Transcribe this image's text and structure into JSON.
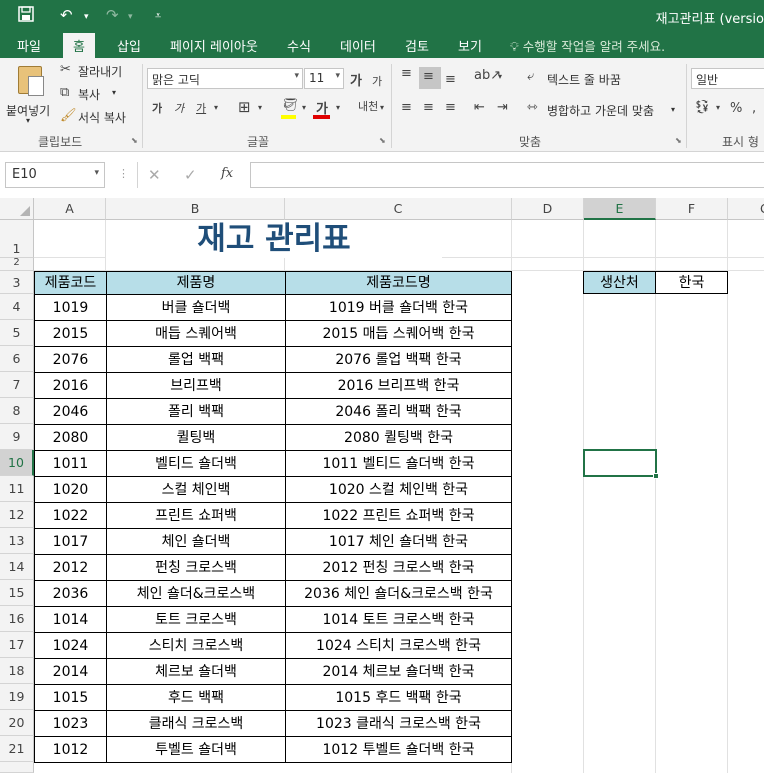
{
  "window": {
    "title": "재고관리표 (versio"
  },
  "menu_tabs": [
    {
      "label": "파일"
    },
    {
      "label": "홈"
    },
    {
      "label": "삽입"
    },
    {
      "label": "페이지 레이아웃"
    },
    {
      "label": "수식"
    },
    {
      "label": "데이터"
    },
    {
      "label": "검토"
    },
    {
      "label": "보기"
    }
  ],
  "tell_me": "수행할 작업을 알려 주세요.",
  "ribbon": {
    "paste_label": "붙여넣기",
    "cut_label": "잘라내기",
    "copy_label": "복사",
    "format_painter_label": "서식 복사",
    "clipboard_group": "클립보드",
    "font_name": "맑은 고딕",
    "font_size": "11",
    "font_group": "글꼴",
    "wrap_text": "텍스트 줄 바꿈",
    "merge_center": "병합하고 가운데 맞춤",
    "alignment_group": "맞춤",
    "number_format": "일반",
    "number_group": "표시 형"
  },
  "formula_bar": {
    "name_box": "E10",
    "fx": "fx",
    "formula": ""
  },
  "columns": [
    "A",
    "B",
    "C",
    "D",
    "E",
    "F",
    "G"
  ],
  "rows": [
    "1",
    "2",
    "3",
    "4",
    "5",
    "6",
    "7",
    "8",
    "9",
    "10",
    "11",
    "12",
    "13",
    "14",
    "15",
    "16",
    "17",
    "18",
    "19",
    "20",
    "21"
  ],
  "sheet": {
    "title": "재고 관리표",
    "headers": [
      "제품코드",
      "제품명",
      "제품코드명"
    ],
    "items": [
      [
        "1019",
        "버클 숄더백",
        "1019 버클 숄더백 한국"
      ],
      [
        "2015",
        "매듭 스퀘어백",
        "2015 매듭 스퀘어백 한국"
      ],
      [
        "2076",
        "롤업 백팩",
        "2076 롤업 백팩 한국"
      ],
      [
        "2016",
        "브리프백",
        "2016 브리프백 한국"
      ],
      [
        "2046",
        "폴리 백팩",
        "2046 폴리 백팩 한국"
      ],
      [
        "2080",
        "퀼팅백",
        "2080 퀼팅백 한국"
      ],
      [
        "1011",
        "벨티드 숄더백",
        "1011 벨티드 숄더백 한국"
      ],
      [
        "1020",
        "스컬 체인백",
        "1020 스컬 체인백 한국"
      ],
      [
        "1022",
        "프린트 쇼퍼백",
        "1022 프린트 쇼퍼백 한국"
      ],
      [
        "1017",
        "체인 숄더백",
        "1017 체인 숄더백 한국"
      ],
      [
        "2012",
        "펀칭 크로스백",
        "2012 펀칭 크로스백 한국"
      ],
      [
        "2036",
        "체인 숄더&크로스백",
        "2036 체인 숄더&크로스백 한국"
      ],
      [
        "1014",
        "토트 크로스백",
        "1014 토트 크로스백 한국"
      ],
      [
        "1024",
        "스티치 크로스백",
        "1024 스티치 크로스백 한국"
      ],
      [
        "2014",
        "체르보 숄더백",
        "2014 체르보 숄더백 한국"
      ],
      [
        "1015",
        "후드 백팩",
        "1015 후드 백팩 한국"
      ],
      [
        "1023",
        "클래식 크로스백",
        "1023 클래식 크로스백 한국"
      ],
      [
        "1012",
        "투벨트 숄더백",
        "1012 투벨트 숄더백 한국"
      ]
    ],
    "origin_label": "생산처",
    "origin_value": "한국"
  },
  "colors": {
    "excel_green": "#217346",
    "header_fill": "#b7dee8",
    "title_color": "#1f4e79"
  }
}
